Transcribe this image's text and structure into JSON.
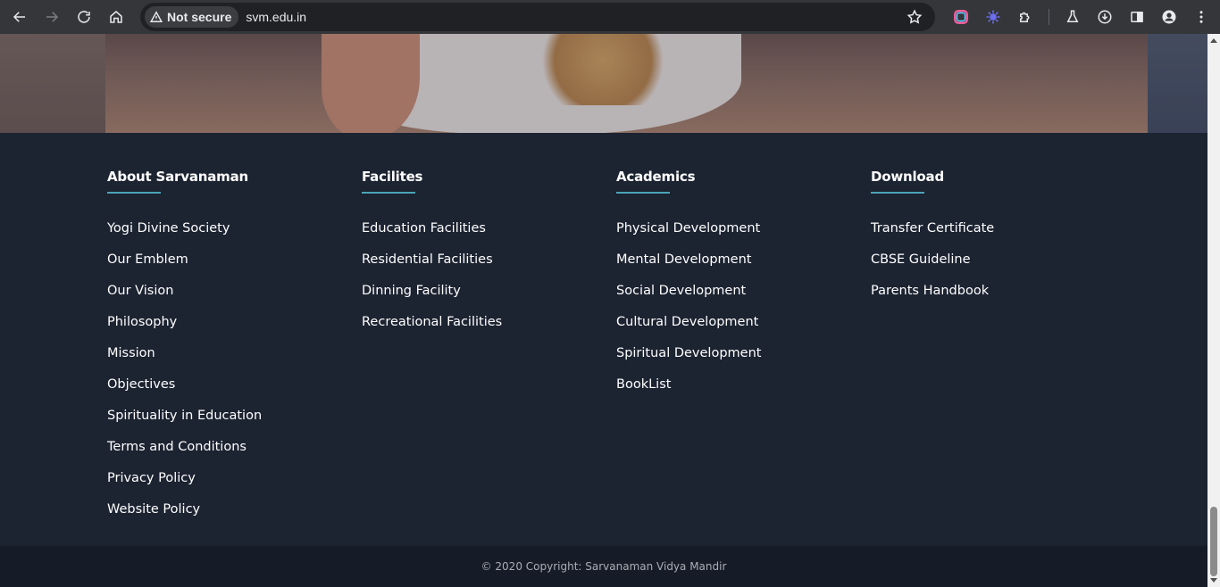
{
  "browser": {
    "security_label": "Not secure",
    "url": "svm.edu.in"
  },
  "footer": {
    "columns": [
      {
        "heading": "About Sarvanaman",
        "links": [
          "Yogi Divine Society",
          "Our Emblem",
          "Our Vision",
          "Philosophy",
          "Mission",
          "Objectives",
          "Spirituality in Education",
          "Terms and Conditions",
          "Privacy Policy",
          "Website Policy"
        ]
      },
      {
        "heading": "Facilites",
        "links": [
          "Education Facilities",
          "Residential Facilities",
          "Dinning Facility",
          "Recreational Facilities"
        ]
      },
      {
        "heading": "Academics",
        "links": [
          "Physical Development",
          "Mental Development",
          "Social Development",
          "Cultural Development",
          "Spiritual Development",
          "BookList"
        ]
      },
      {
        "heading": "Download",
        "links": [
          "Transfer Certificate",
          "CBSE Guideline",
          "Parents Handbook"
        ]
      }
    ],
    "copyright": "© 2020 Copyright: Sarvanaman Vidya Mandir"
  },
  "colors": {
    "footer_bg": "#1c2331",
    "copyright_bg": "#161c27",
    "accent_underline": "#4aa3b8"
  }
}
